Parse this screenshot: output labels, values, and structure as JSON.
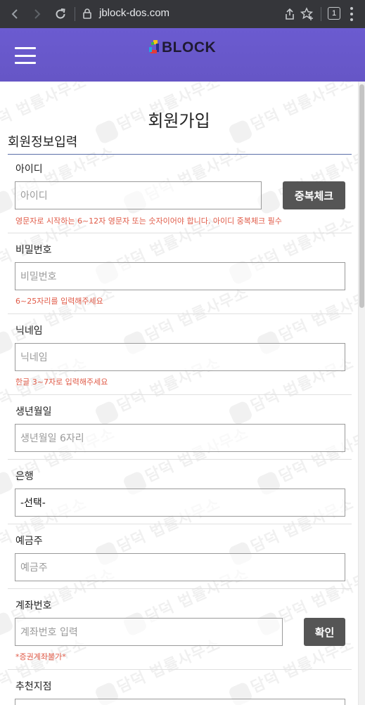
{
  "browser": {
    "url": "jblock-dos.com",
    "tab_count": "1"
  },
  "header": {
    "logo_text": "BLOCK"
  },
  "page": {
    "title": "회원가입",
    "section_title": "회원정보입력"
  },
  "form": {
    "id": {
      "label": "아이디",
      "placeholder": "아이디",
      "check_button": "중복체크",
      "hint": "영문자로 시작하는 6~12자 영문자 또는 숫자이어야 합니다. 아이디 중복체크 필수"
    },
    "password": {
      "label": "비밀번호",
      "placeholder": "비밀번호",
      "hint": "6~25자리를 입력해주세요"
    },
    "nickname": {
      "label": "닉네임",
      "placeholder": "닉네임",
      "hint": "한글 3~7자로 입력해주세요"
    },
    "birth": {
      "label": "생년월일",
      "placeholder": "생년월일 6자리"
    },
    "bank": {
      "label": "은행",
      "selected": "-선택-"
    },
    "holder": {
      "label": "예금주",
      "placeholder": "예금주"
    },
    "account": {
      "label": "계좌번호",
      "placeholder": "계좌번호 입력",
      "confirm_button": "확인",
      "hint": "*증권계좌불가*"
    },
    "referral": {
      "label": "추천지점"
    }
  },
  "watermark": {
    "text": "담덕 법률사무소"
  },
  "colors": {
    "header_bg": "#6a5acd",
    "hint_red": "#e05a47",
    "button_gray": "#555555",
    "browser_bar": "#35363a"
  }
}
